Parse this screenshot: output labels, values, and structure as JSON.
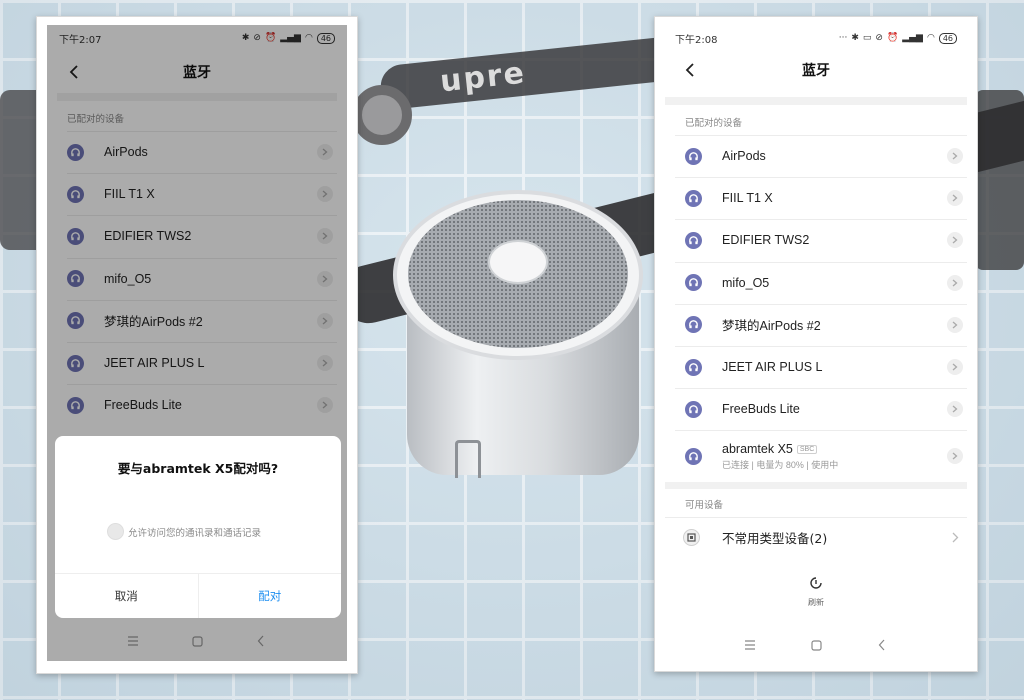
{
  "background": {
    "strap_text": "upre"
  },
  "left_phone": {
    "status": {
      "time": "下午2:07",
      "battery": "46"
    },
    "title": "蓝牙",
    "section_paired": "已配对的设备",
    "devices": [
      {
        "name": "AirPods"
      },
      {
        "name": "FIIL T1 X"
      },
      {
        "name": "EDIFIER TWS2"
      },
      {
        "name": "mifo_O5"
      },
      {
        "name": "梦琪的AirPods #2"
      },
      {
        "name": "JEET AIR PLUS L"
      },
      {
        "name": "FreeBuds Lite"
      }
    ],
    "dialog": {
      "title": "要与abramtek  X5配对吗?",
      "checkbox_label": "允许访问您的通讯录和通话记录",
      "cancel": "取消",
      "pair": "配对"
    }
  },
  "right_phone": {
    "status": {
      "time": "下午2:08",
      "battery": "46"
    },
    "title": "蓝牙",
    "section_paired": "已配对的设备",
    "devices": [
      {
        "name": "AirPods"
      },
      {
        "name": "FIIL T1 X"
      },
      {
        "name": "EDIFIER TWS2"
      },
      {
        "name": "mifo_O5"
      },
      {
        "name": "梦琪的AirPods #2"
      },
      {
        "name": "JEET AIR PLUS L"
      },
      {
        "name": "FreeBuds Lite"
      }
    ],
    "connected_device": {
      "name": "abramtek X5",
      "codec": "SBC",
      "status": "已连接 | 电量为 80% | 使用中"
    },
    "section_available": "可用设备",
    "available_device": "不常用类型设备(2)",
    "refresh": "刷新"
  },
  "colors": {
    "accent_blue": "#1f8ff0",
    "device_icon": "#6f74b5"
  },
  "icons": {
    "device": "headphones-icon",
    "back": "back-arrow-icon",
    "row_chevron": "chevron-right-icon",
    "refresh": "refresh-icon",
    "nav": [
      "menu-icon",
      "home-icon",
      "back-icon"
    ]
  }
}
